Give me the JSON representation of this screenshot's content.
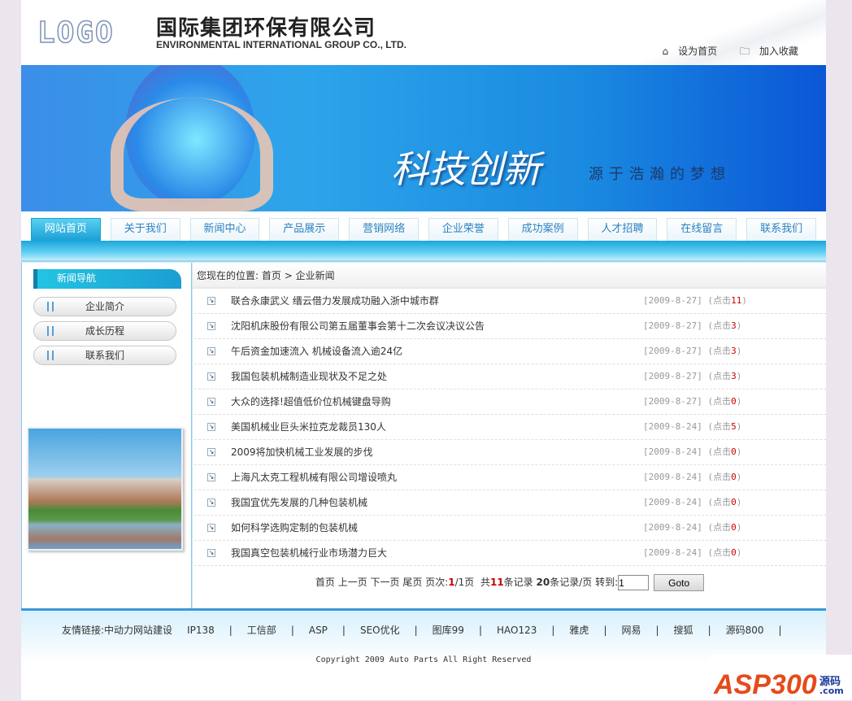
{
  "header": {
    "logo": "LOGO",
    "company_cn": "国际集团环保有限公司",
    "company_en": "ENVIRONMENTAL INTERNATIONAL GROUP CO., LTD.",
    "set_home": "设为首页",
    "add_fav": "加入收藏"
  },
  "banner": {
    "slogan_main": "科技创新",
    "slogan_sub": "源于浩瀚的梦想"
  },
  "nav": [
    "网站首页",
    "关于我们",
    "新闻中心",
    "产品展示",
    "营销网络",
    "企业荣誉",
    "成功案例",
    "人才招聘",
    "在线留言",
    "联系我们"
  ],
  "sidebar": {
    "title": "新闻导航",
    "items": [
      "企业简介",
      "成长历程",
      "联系我们"
    ]
  },
  "breadcrumb": {
    "prefix": "您现在的位置:",
    "home": "首页",
    "sep": ">",
    "current": "企业新闻"
  },
  "news": [
    {
      "title": "联合永康武义 缙云借力发展成功融入浙中城市群",
      "date": "[2009-8-27]",
      "clicks_label": "(点击",
      "clicks": "11",
      "close": ")"
    },
    {
      "title": "沈阳机床股份有限公司第五届董事会第十二次会议决议公告",
      "date": "[2009-8-27]",
      "clicks_label": "(点击",
      "clicks": "3",
      "close": ")"
    },
    {
      "title": "午后资金加速流入 机械设备流入逾24亿",
      "date": "[2009-8-27]",
      "clicks_label": "(点击",
      "clicks": "3",
      "close": ")"
    },
    {
      "title": "我国包装机械制造业现状及不足之处",
      "date": "[2009-8-27]",
      "clicks_label": "(点击",
      "clicks": "3",
      "close": ")"
    },
    {
      "title": "大众的选择!超值低价位机械键盘导购",
      "date": "[2009-8-27]",
      "clicks_label": "(点击",
      "clicks": "0",
      "close": ")"
    },
    {
      "title": "美国机械业巨头米拉克龙裁员130人",
      "date": "[2009-8-24]",
      "clicks_label": "(点击",
      "clicks": "5",
      "close": ")"
    },
    {
      "title": "2009将加快机械工业发展的步伐",
      "date": "[2009-8-24]",
      "clicks_label": "(点击",
      "clicks": "0",
      "close": ")"
    },
    {
      "title": "上海凡太克工程机械有限公司增设喷丸",
      "date": "[2009-8-24]",
      "clicks_label": "(点击",
      "clicks": "0",
      "close": ")"
    },
    {
      "title": "我国宜优先发展的几种包装机械",
      "date": "[2009-8-24]",
      "clicks_label": "(点击",
      "clicks": "0",
      "close": ")"
    },
    {
      "title": "如何科学选购定制的包装机械",
      "date": "[2009-8-24]",
      "clicks_label": "(点击",
      "clicks": "0",
      "close": ")"
    },
    {
      "title": "我国真空包装机械行业市场潜力巨大",
      "date": "[2009-8-24]",
      "clicks_label": "(点击",
      "clicks": "0",
      "close": ")"
    }
  ],
  "pager": {
    "first": "首页",
    "prev": "上一页",
    "next": "下一页",
    "last": "尾页",
    "page_label": "页次:",
    "page": "1",
    "page_total": "/1页",
    "total_pre": "共",
    "total": "11",
    "total_post": "条记录",
    "per_page": "20",
    "per_page_post": "条记录/页",
    "goto_label": "转到:",
    "goto_value": "1",
    "goto_button": "Goto"
  },
  "footer": {
    "links_label": "友情链接:",
    "links": [
      "中动力网站建设",
      "IP138",
      "工信部",
      "ASP",
      "SEO优化",
      "图库99",
      "HAO123",
      "雅虎",
      "网易",
      "搜狐",
      "源码800"
    ],
    "sep": "|",
    "copyright": "Copyright 2009 Auto Parts All Right Reserved"
  },
  "watermark": {
    "brand": "ASP300",
    "cn": "源码",
    "domain": ".com"
  }
}
